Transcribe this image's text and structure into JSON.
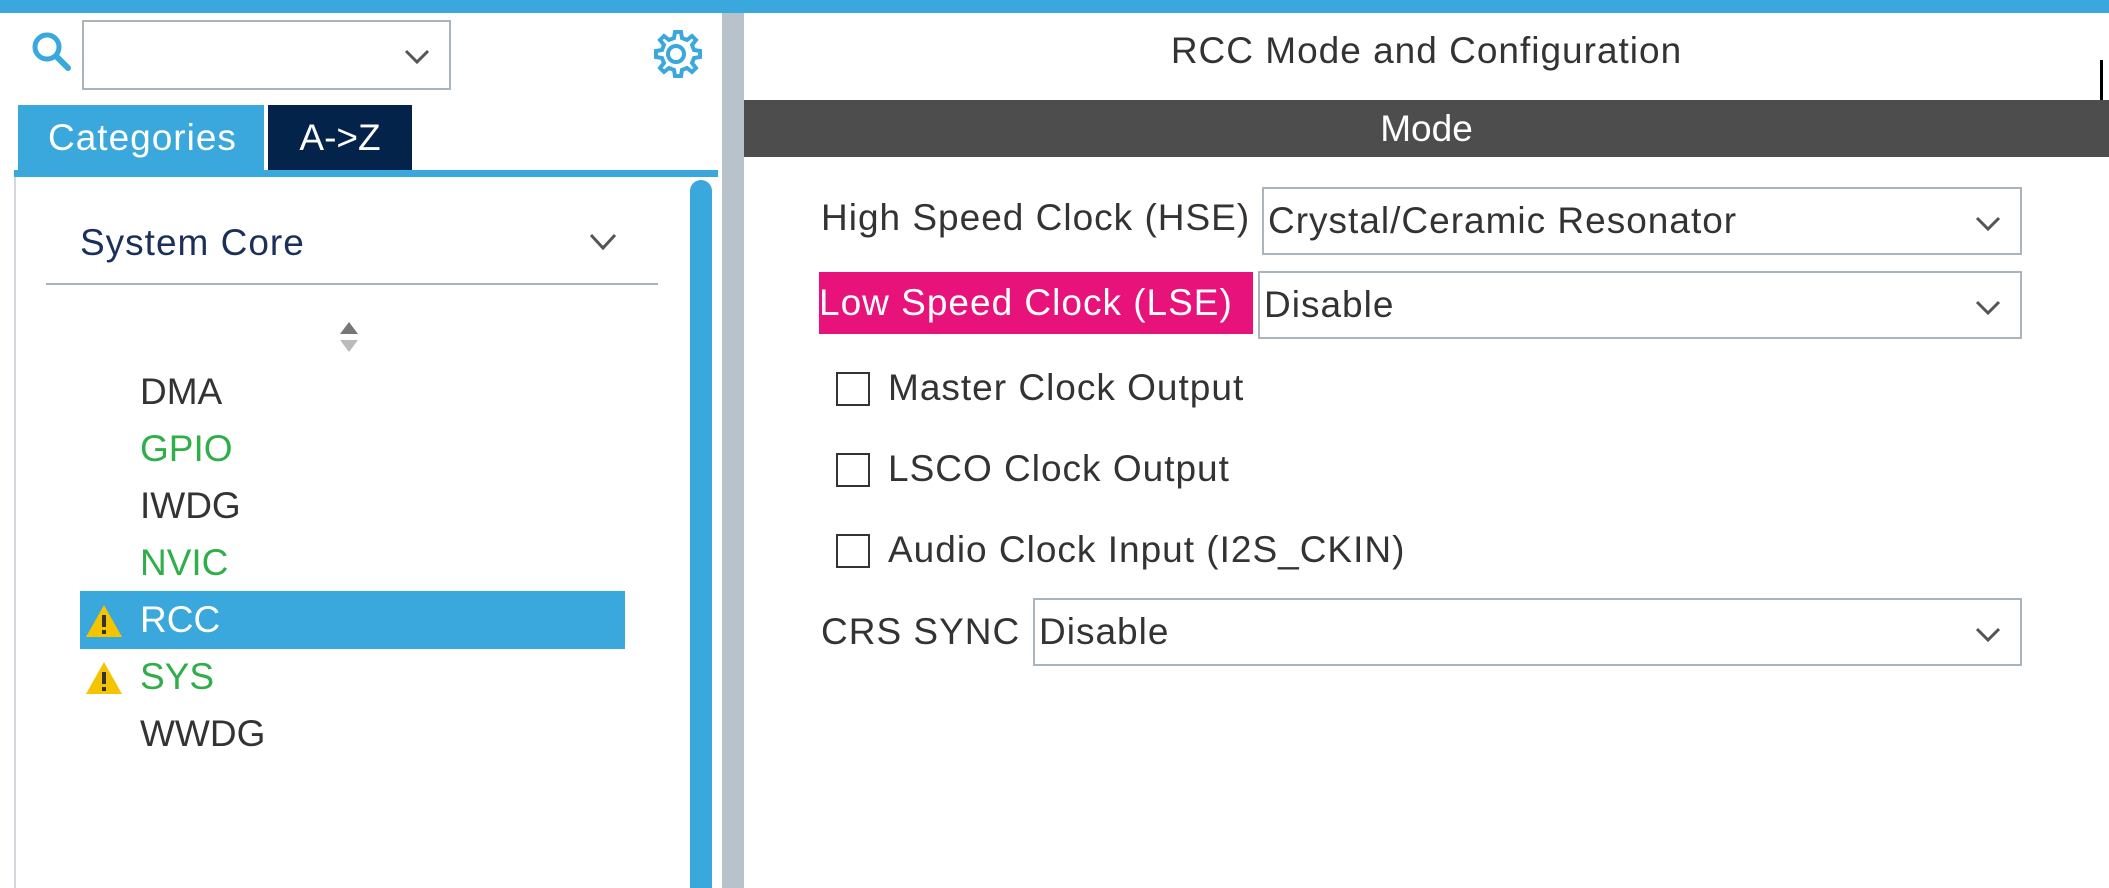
{
  "search": {
    "value": ""
  },
  "tabs": {
    "categories": "Categories",
    "az": "A->Z"
  },
  "category": {
    "title": "System Core",
    "items": [
      {
        "label": "DMA",
        "color": "#333333",
        "warning": false,
        "selected": false
      },
      {
        "label": "GPIO",
        "color": "#2fae4a",
        "warning": false,
        "selected": false
      },
      {
        "label": "IWDG",
        "color": "#333333",
        "warning": false,
        "selected": false
      },
      {
        "label": "NVIC",
        "color": "#2fae4a",
        "warning": false,
        "selected": false
      },
      {
        "label": "RCC",
        "color": "#ffffff",
        "warning": true,
        "selected": true
      },
      {
        "label": "SYS",
        "color": "#2fae4a",
        "warning": true,
        "selected": false
      },
      {
        "label": "WWDG",
        "color": "#333333",
        "warning": false,
        "selected": false
      }
    ]
  },
  "panel": {
    "title": "RCC Mode and Configuration",
    "section": "Mode",
    "hse": {
      "label": "High Speed Clock (HSE)",
      "value": "Crystal/Ceramic Resonator"
    },
    "lse": {
      "label": "Low Speed Clock (LSE)",
      "value": "Disable"
    },
    "checkboxes": [
      {
        "label": "Master Clock Output",
        "checked": false
      },
      {
        "label": "LSCO Clock Output",
        "checked": false
      },
      {
        "label": "Audio Clock Input (I2S_CKIN)",
        "checked": false
      }
    ],
    "crs": {
      "label": "CRS SYNC",
      "value": "Disable"
    }
  },
  "colors": {
    "accent": "#3aa7dd",
    "dark_tab": "#03234b",
    "highlight": "#e8137a",
    "mode_bar": "#4d4d4d",
    "green_item": "#2fae4a",
    "warning": "#f5c400"
  }
}
